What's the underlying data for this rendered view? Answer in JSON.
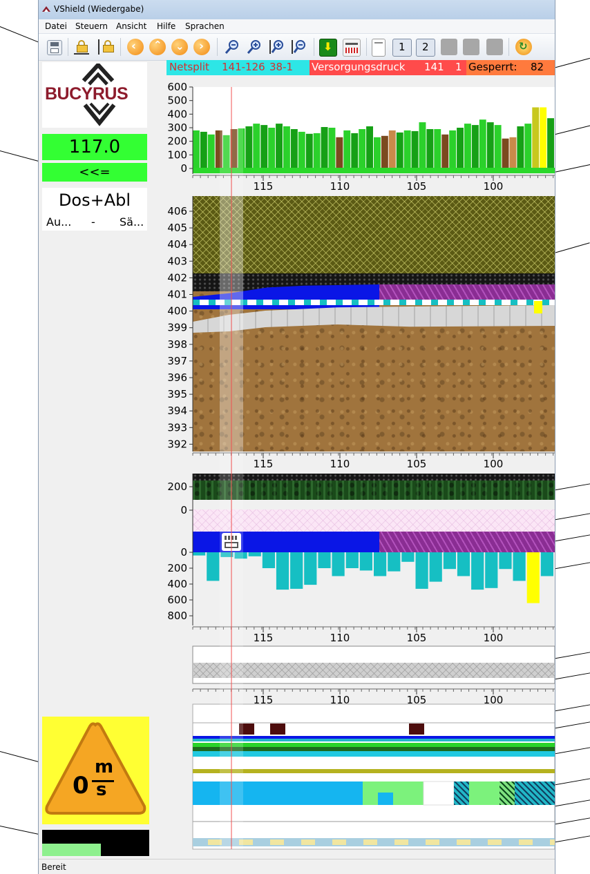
{
  "window": {
    "title": "VShield (Wiedergabe)"
  },
  "menu": [
    "Datei",
    "Steuern",
    "Ansicht",
    "Hilfe",
    "Sprachen"
  ],
  "toolbar": {
    "icons": [
      "save-icon",
      "lock-horizontal-icon",
      "lock-vertical-icon",
      "arrow-left-icon",
      "arrow-up-icon",
      "arrow-down-icon",
      "arrow-right-icon",
      "zoom-out-icon",
      "zoom-in-icon",
      "zoom-vertical-in-icon",
      "zoom-vertical-out-icon",
      "download-icon",
      "chart-icon",
      "page-icon",
      "view-1-button",
      "view-2-button",
      "gray-button-1",
      "gray-button-2",
      "gray-button-3",
      "refresh-icon"
    ],
    "view1_label": "1",
    "view2_label": "2"
  },
  "left_panel": {
    "logo_text": "BUCYRUS",
    "value": "117.0",
    "direction": "<<=",
    "mode": "Dos+Abl",
    "mode_sub_left": "Au...",
    "mode_sub_mid": "-",
    "mode_sub_right": "Sä...",
    "speed_value": "0",
    "speed_unit_top": "m",
    "speed_unit_bottom": "s",
    "progress": 0.55
  },
  "status_banner": {
    "netsplit_label": "Netsplit",
    "netsplit_range": "141-126",
    "netsplit_value": "38-1",
    "pressure_label": "Versorgungsdruck",
    "pressure_value": "141",
    "pressure_index": "1",
    "locked_label": "Gesperrt:",
    "locked_value": "82"
  },
  "colors": {
    "banner_cyan": "#2de6e6",
    "banner_red": "#ff4b4b",
    "banner_orange": "#ff7a3d",
    "value_green": "#3cf23c",
    "warning_yellow": "#ffff33",
    "warning_orange": "#f5a623",
    "cyan_bar": "#16bfc3",
    "blue_layer": "#0a16e6"
  },
  "chart_data": [
    {
      "type": "bar",
      "ylim": [
        0,
        600
      ],
      "yticks": [
        "600",
        "500",
        "400",
        "300",
        "200",
        "100",
        "0"
      ],
      "xticks": [
        "115",
        "110",
        "105",
        "100"
      ],
      "values": [
        280,
        270,
        250,
        280,
        245,
        290,
        295,
        310,
        330,
        320,
        300,
        330,
        310,
        290,
        270,
        255,
        260,
        305,
        300,
        230,
        280,
        260,
        290,
        310,
        230,
        240,
        280,
        265,
        280,
        275,
        340,
        290,
        290,
        250,
        280,
        300,
        330,
        320,
        360,
        340,
        320,
        220,
        230,
        310,
        330,
        450,
        450,
        370
      ]
    },
    {
      "type": "area",
      "ylim": [
        392,
        406
      ],
      "yticks": [
        "406",
        "405",
        "404",
        "403",
        "402",
        "401",
        "400",
        "399",
        "398",
        "397",
        "396",
        "395",
        "394",
        "393",
        "392"
      ],
      "xticks": [
        "115",
        "110",
        "105",
        "100"
      ]
    },
    {
      "type": "area",
      "yticks": [
        "200",
        "0"
      ],
      "xticks": []
    },
    {
      "type": "bar",
      "ylim": [
        0,
        800
      ],
      "yticks": [
        "0",
        "200",
        "400",
        "600",
        "800"
      ],
      "xticks": [
        "115",
        "110",
        "105",
        "100"
      ],
      "values": [
        40,
        360,
        60,
        80,
        50,
        200,
        470,
        460,
        410,
        200,
        300,
        200,
        230,
        300,
        240,
        120,
        460,
        370,
        210,
        300,
        470,
        450,
        210,
        360,
        640,
        300
      ]
    },
    {
      "type": "table",
      "xticks": [
        "115",
        "110",
        "105",
        "100"
      ]
    }
  ],
  "statusbar": {
    "text": "Bereit"
  }
}
